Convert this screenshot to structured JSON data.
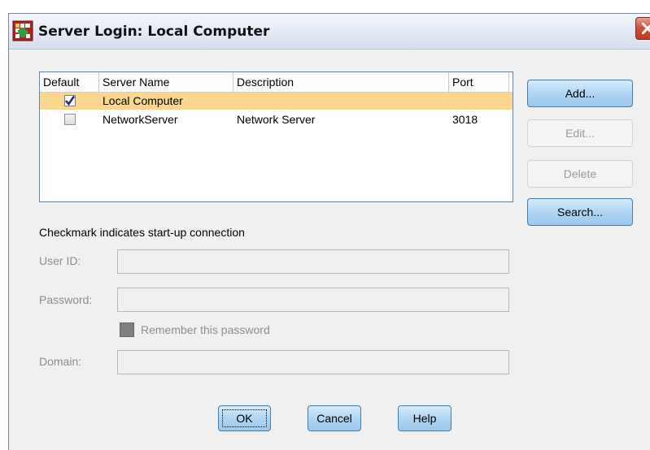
{
  "window": {
    "title": "Server Login: Local Computer"
  },
  "server_table": {
    "columns": [
      "Default",
      "Server Name",
      "Description",
      "Port"
    ],
    "rows": [
      {
        "default": true,
        "server_name": "Local Computer",
        "description": "",
        "port": "",
        "selected": true
      },
      {
        "default": false,
        "server_name": "NetworkServer",
        "description": "Network Server",
        "port": "3018",
        "selected": false
      }
    ]
  },
  "side_buttons": {
    "add": "Add...",
    "edit": "Edit...",
    "delete": "Delete",
    "search": "Search..."
  },
  "hint": "Checkmark indicates start-up connection",
  "fields": {
    "user_id_label": "User ID:",
    "user_id_value": "",
    "password_label": "Password:",
    "password_value": "",
    "remember_label": "Remember this password",
    "domain_label": "Domain:",
    "domain_value": ""
  },
  "buttons": {
    "ok": "OK",
    "cancel": "Cancel",
    "help": "Help"
  },
  "icons": {
    "app": "spss-grid-icon",
    "close": "close-icon",
    "check": "checkmark-icon"
  },
  "colors": {
    "selected_row": "#fcd68c",
    "button_blue": "#b1d5f2",
    "close_red": "#c13a24"
  }
}
